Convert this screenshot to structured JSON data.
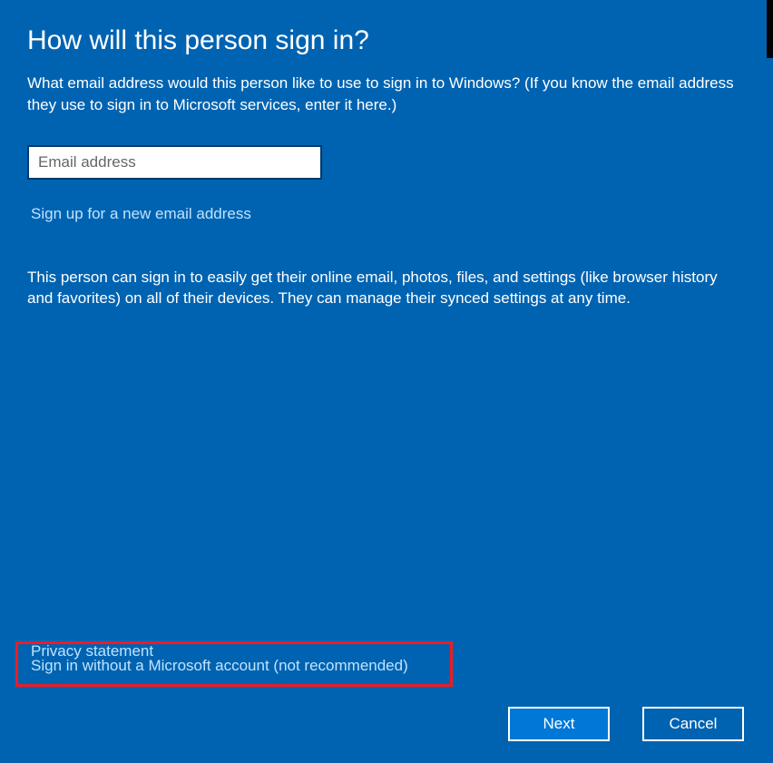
{
  "title": "How will this person sign in?",
  "description": "What email address would this person like to use to sign in to Windows? (If you know the email address they use to sign in to Microsoft services, enter it here.)",
  "email_input": {
    "placeholder": "Email address",
    "value": ""
  },
  "signup_link": "Sign up for a new email address",
  "info_text": "This person can sign in to easily get their online email, photos, files, and settings (like browser history and favorites) on all of their devices. They can manage their synced settings at any time.",
  "privacy_link": "Privacy statement",
  "signin_without_link": "Sign in without a Microsoft account (not recommended)",
  "buttons": {
    "next": "Next",
    "cancel": "Cancel"
  }
}
